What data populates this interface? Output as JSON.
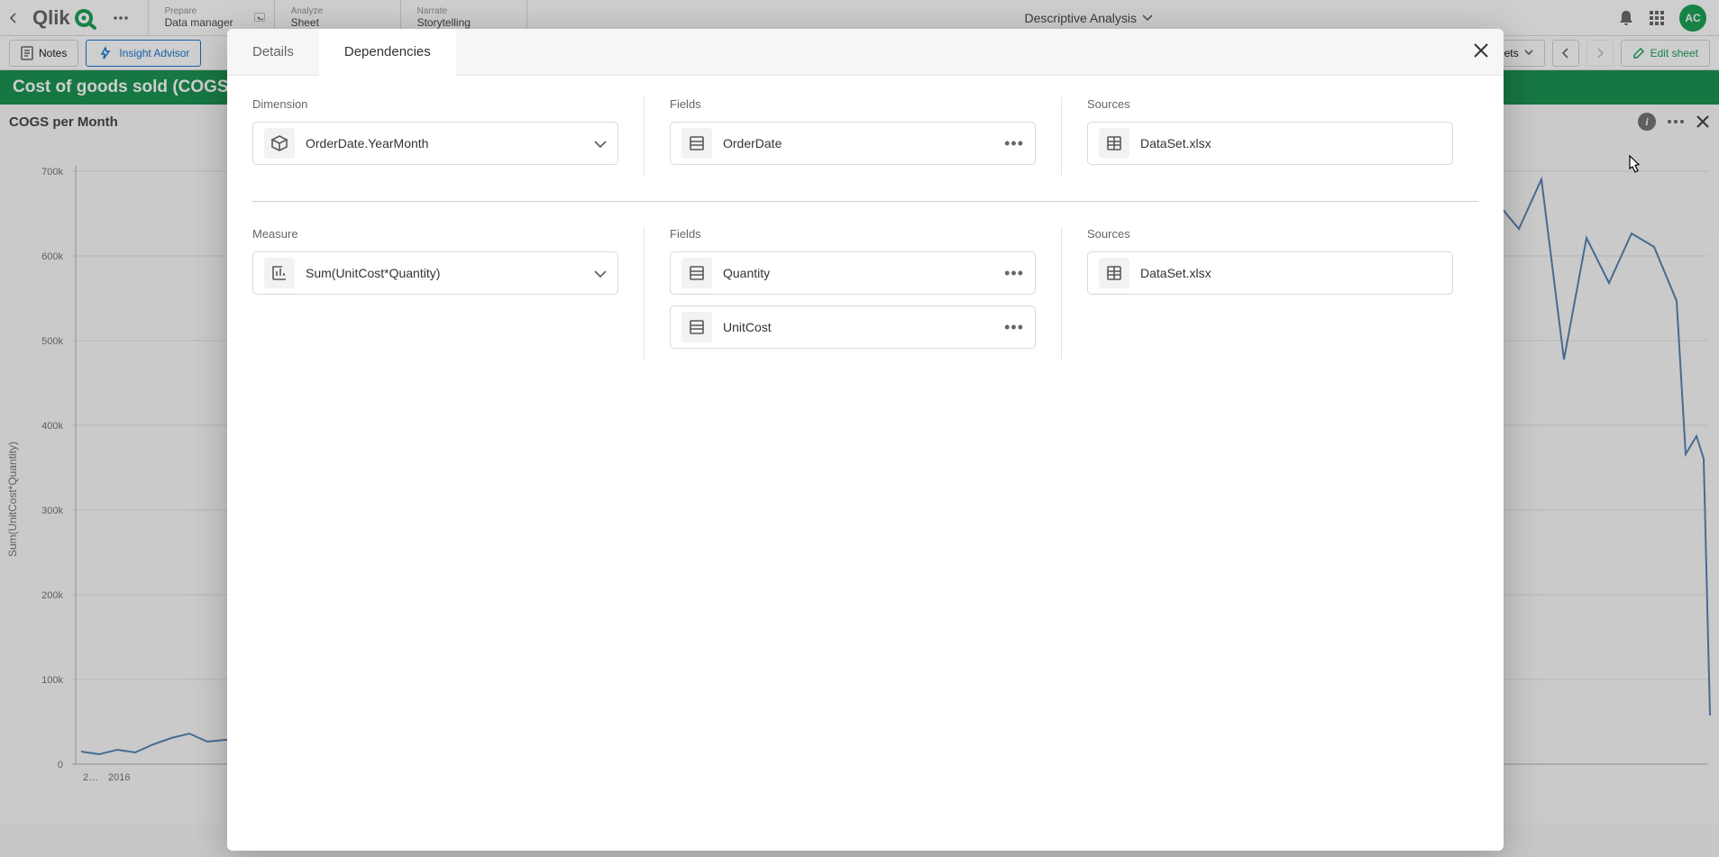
{
  "topbar": {
    "logo_text": "Qlik",
    "nav": [
      {
        "top": "Prepare",
        "bottom": "Data manager",
        "has_dropdown": true
      },
      {
        "top": "Analyze",
        "bottom": "Sheet"
      },
      {
        "top": "Narrate",
        "bottom": "Storytelling"
      }
    ],
    "center_title": "Descriptive Analysis",
    "avatar": "AC"
  },
  "secondbar": {
    "notes": "Notes",
    "insight": "Insight Advisor",
    "sheets": "Sheets",
    "edit": "Edit sheet"
  },
  "sheet": {
    "title": "Cost of goods sold (COGS)"
  },
  "chart": {
    "title": "COGS per Month",
    "xlabel": "OrderDate.YearMonth",
    "ylabel": "Sum(UnitCost*Quantity)",
    "x_ticks": [
      "2...",
      "2016"
    ]
  },
  "chart_data": {
    "type": "line",
    "title": "COGS per Month",
    "xlabel": "OrderDate.YearMonth",
    "ylabel": "Sum(UnitCost*Quantity)",
    "ylim": [
      0,
      700000
    ],
    "y_ticks": [
      0,
      100000,
      200000,
      300000,
      400000,
      500000,
      600000,
      700000
    ],
    "y_tick_labels": [
      "0",
      "100k",
      "200k",
      "300k",
      "400k",
      "500k",
      "600k",
      "700k"
    ],
    "x": [
      1,
      2,
      3,
      4,
      5,
      6,
      7,
      8,
      75,
      76,
      77,
      78,
      79,
      80,
      81,
      82,
      83,
      84,
      85,
      86,
      87
    ],
    "values": [
      15000,
      12000,
      18000,
      14000,
      23000,
      30000,
      35000,
      25000,
      660000,
      620000,
      690000,
      480000,
      630000,
      570000,
      630000,
      615000,
      545000,
      370000,
      390000,
      365000,
      60000
    ],
    "note": "left-most and right-most visible portions only; center is occluded by modal"
  },
  "modal": {
    "tabs": {
      "details": "Details",
      "dependencies": "Dependencies",
      "active": "dependencies"
    },
    "section1": {
      "dimension_label": "Dimension",
      "dimension_value": "OrderDate.YearMonth",
      "fields_label": "Fields",
      "fields": [
        "OrderDate"
      ],
      "sources_label": "Sources",
      "sources": [
        "DataSet.xlsx"
      ]
    },
    "section2": {
      "measure_label": "Measure",
      "measure_value": "Sum(UnitCost*Quantity)",
      "fields_label": "Fields",
      "fields": [
        "Quantity",
        "UnitCost"
      ],
      "sources_label": "Sources",
      "sources": [
        "DataSet.xlsx"
      ]
    }
  }
}
